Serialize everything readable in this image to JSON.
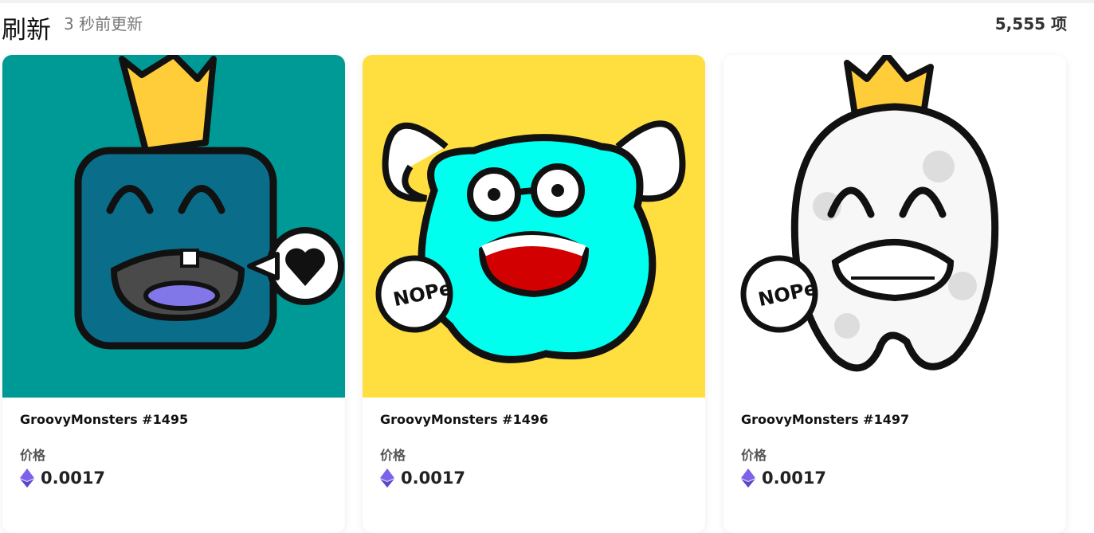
{
  "header": {
    "title": "刷新",
    "updated": "3 秒前更新",
    "count": "5,555 项"
  },
  "colors": {
    "teal": "#009a96",
    "yellow": "#ffdf3f",
    "cyan": "#00ffee",
    "accent_purple": "#7b62e8"
  },
  "cards": [
    {
      "name": "GroovyMonsters #1495",
      "price_label": "价格",
      "price": "0.0017",
      "currency_icon": "ethereum-icon"
    },
    {
      "name": "GroovyMonsters #1496",
      "price_label": "价格",
      "price": "0.0017",
      "currency_icon": "ethereum-icon"
    },
    {
      "name": "GroovyMonsters #1497",
      "price_label": "价格",
      "price": "0.0017",
      "currency_icon": "ethereum-icon"
    }
  ],
  "speech_bubble_text": "NOPe"
}
